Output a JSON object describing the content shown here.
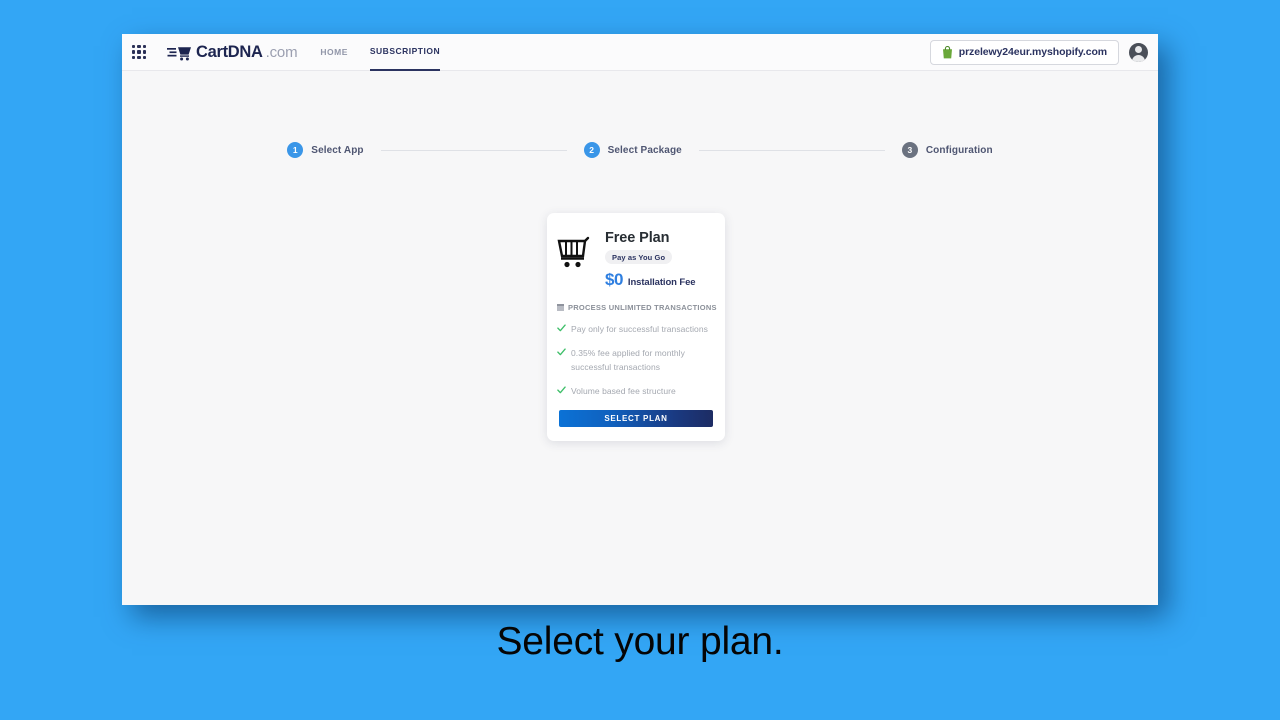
{
  "caption": "Select your plan.",
  "colors": {
    "background": "#33a6f5",
    "accent_blue": "#3a96e8",
    "navy": "#2b3360",
    "price_blue": "#2f7fe0",
    "check_green": "#3fbf6a",
    "shopify_green": "#5f9f35"
  },
  "topbar": {
    "apps_icon": "grid-apps-icon",
    "logo": {
      "icon": "cart-speed-icon",
      "name": "CartDNA",
      "tld": ".com"
    },
    "nav": [
      {
        "label": "HOME",
        "active": false
      },
      {
        "label": "SUBSCRIPTION",
        "active": true
      }
    ],
    "store": {
      "icon": "shopify-bag-icon",
      "name": "przelewy24eur.myshopify.com"
    },
    "avatar_icon": "user-avatar-icon"
  },
  "stepper": {
    "steps": [
      {
        "num": "1",
        "label": "Select App",
        "state": "active"
      },
      {
        "num": "2",
        "label": "Select Package",
        "state": "active"
      },
      {
        "num": "3",
        "label": "Configuration",
        "state": "inactive"
      }
    ]
  },
  "plan_card": {
    "icon": "shopping-cart-icon",
    "title": "Free Plan",
    "badge": "Pay as You Go",
    "price": "$0",
    "price_caption": "Installation Fee",
    "section_icon": "panel-icon",
    "section_title": "PROCESS UNLIMITED TRANSACTIONS",
    "features": [
      "Pay only for successful transactions",
      "0.35% fee applied for monthly successful transactions",
      "Volume based fee structure"
    ],
    "cta": "SELECT PLAN"
  }
}
